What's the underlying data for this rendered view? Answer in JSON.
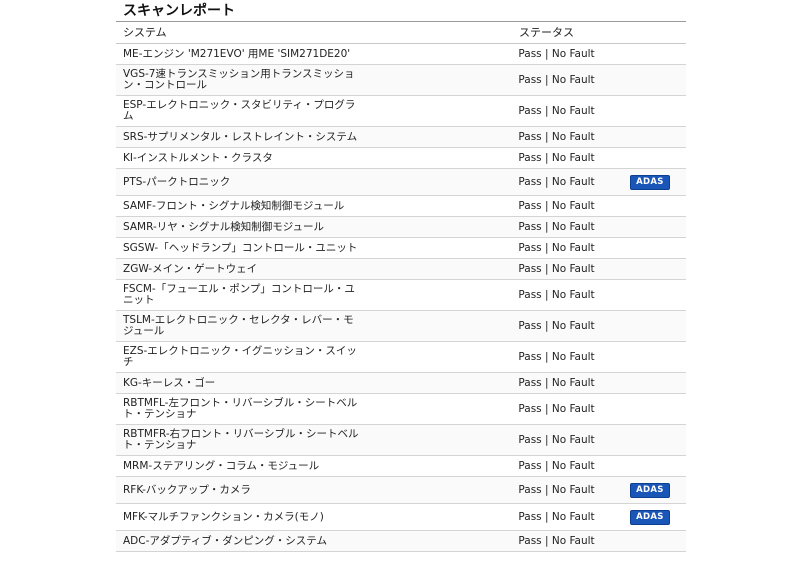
{
  "report": {
    "title": "スキャンレポート",
    "columns": {
      "system": "システム",
      "status": "ステータス"
    },
    "badge_label": "ADAS",
    "rows": [
      {
        "system": "ME-エンジン 'M271EVO' 用ME 'SIM271DE20'",
        "status": "Pass | No Fault",
        "adas": false
      },
      {
        "system": "VGS-7速トランスミッション用トランスミッション・コントロール",
        "status": "Pass | No Fault",
        "adas": false
      },
      {
        "system": "ESP-エレクトロニック・スタビリティ・プログラム",
        "status": "Pass | No Fault",
        "adas": false
      },
      {
        "system": "SRS-サプリメンタル・レストレイント・システム",
        "status": "Pass | No Fault",
        "adas": false
      },
      {
        "system": "KI-インストルメント・クラスタ",
        "status": "Pass | No Fault",
        "adas": false
      },
      {
        "system": "PTS-パークトロニック",
        "status": "Pass | No Fault",
        "adas": true
      },
      {
        "system": "SAMF-フロント・シグナル検知制御モジュール",
        "status": "Pass | No Fault",
        "adas": false
      },
      {
        "system": "SAMR-リヤ・シグナル検知制御モジュール",
        "status": "Pass | No Fault",
        "adas": false
      },
      {
        "system": "SGSW-「ヘッドランプ」コントロール・ユニット",
        "status": "Pass | No Fault",
        "adas": false
      },
      {
        "system": "ZGW-メイン・ゲートウェイ",
        "status": "Pass | No Fault",
        "adas": false
      },
      {
        "system": "FSCM-「フューエル・ポンプ」コントロール・ユニット",
        "status": "Pass | No Fault",
        "adas": false
      },
      {
        "system": "TSLM-エレクトロニック・セレクタ・レバー・モジュール",
        "status": "Pass | No Fault",
        "adas": false
      },
      {
        "system": "EZS-エレクトロニック・イグニッション・スイッチ",
        "status": "Pass | No Fault",
        "adas": false
      },
      {
        "system": "KG-キーレス・ゴー",
        "status": "Pass | No Fault",
        "adas": false
      },
      {
        "system": "RBTMFL-左フロント・リバーシブル・シートベルト・テンショナ",
        "status": "Pass | No Fault",
        "adas": false
      },
      {
        "system": "RBTMFR-右フロント・リバーシブル・シートベルト・テンショナ",
        "status": "Pass | No Fault",
        "adas": false
      },
      {
        "system": "MRM-ステアリング・コラム・モジュール",
        "status": "Pass | No Fault",
        "adas": false
      },
      {
        "system": "RFK-バックアップ・カメラ",
        "status": "Pass | No Fault",
        "adas": true
      },
      {
        "system": "MFK-マルチファンクション・カメラ(モノ)",
        "status": "Pass | No Fault",
        "adas": true
      },
      {
        "system": "ADC-アダプティブ・ダンピング・システム",
        "status": "Pass | No Fault",
        "adas": false
      }
    ]
  }
}
